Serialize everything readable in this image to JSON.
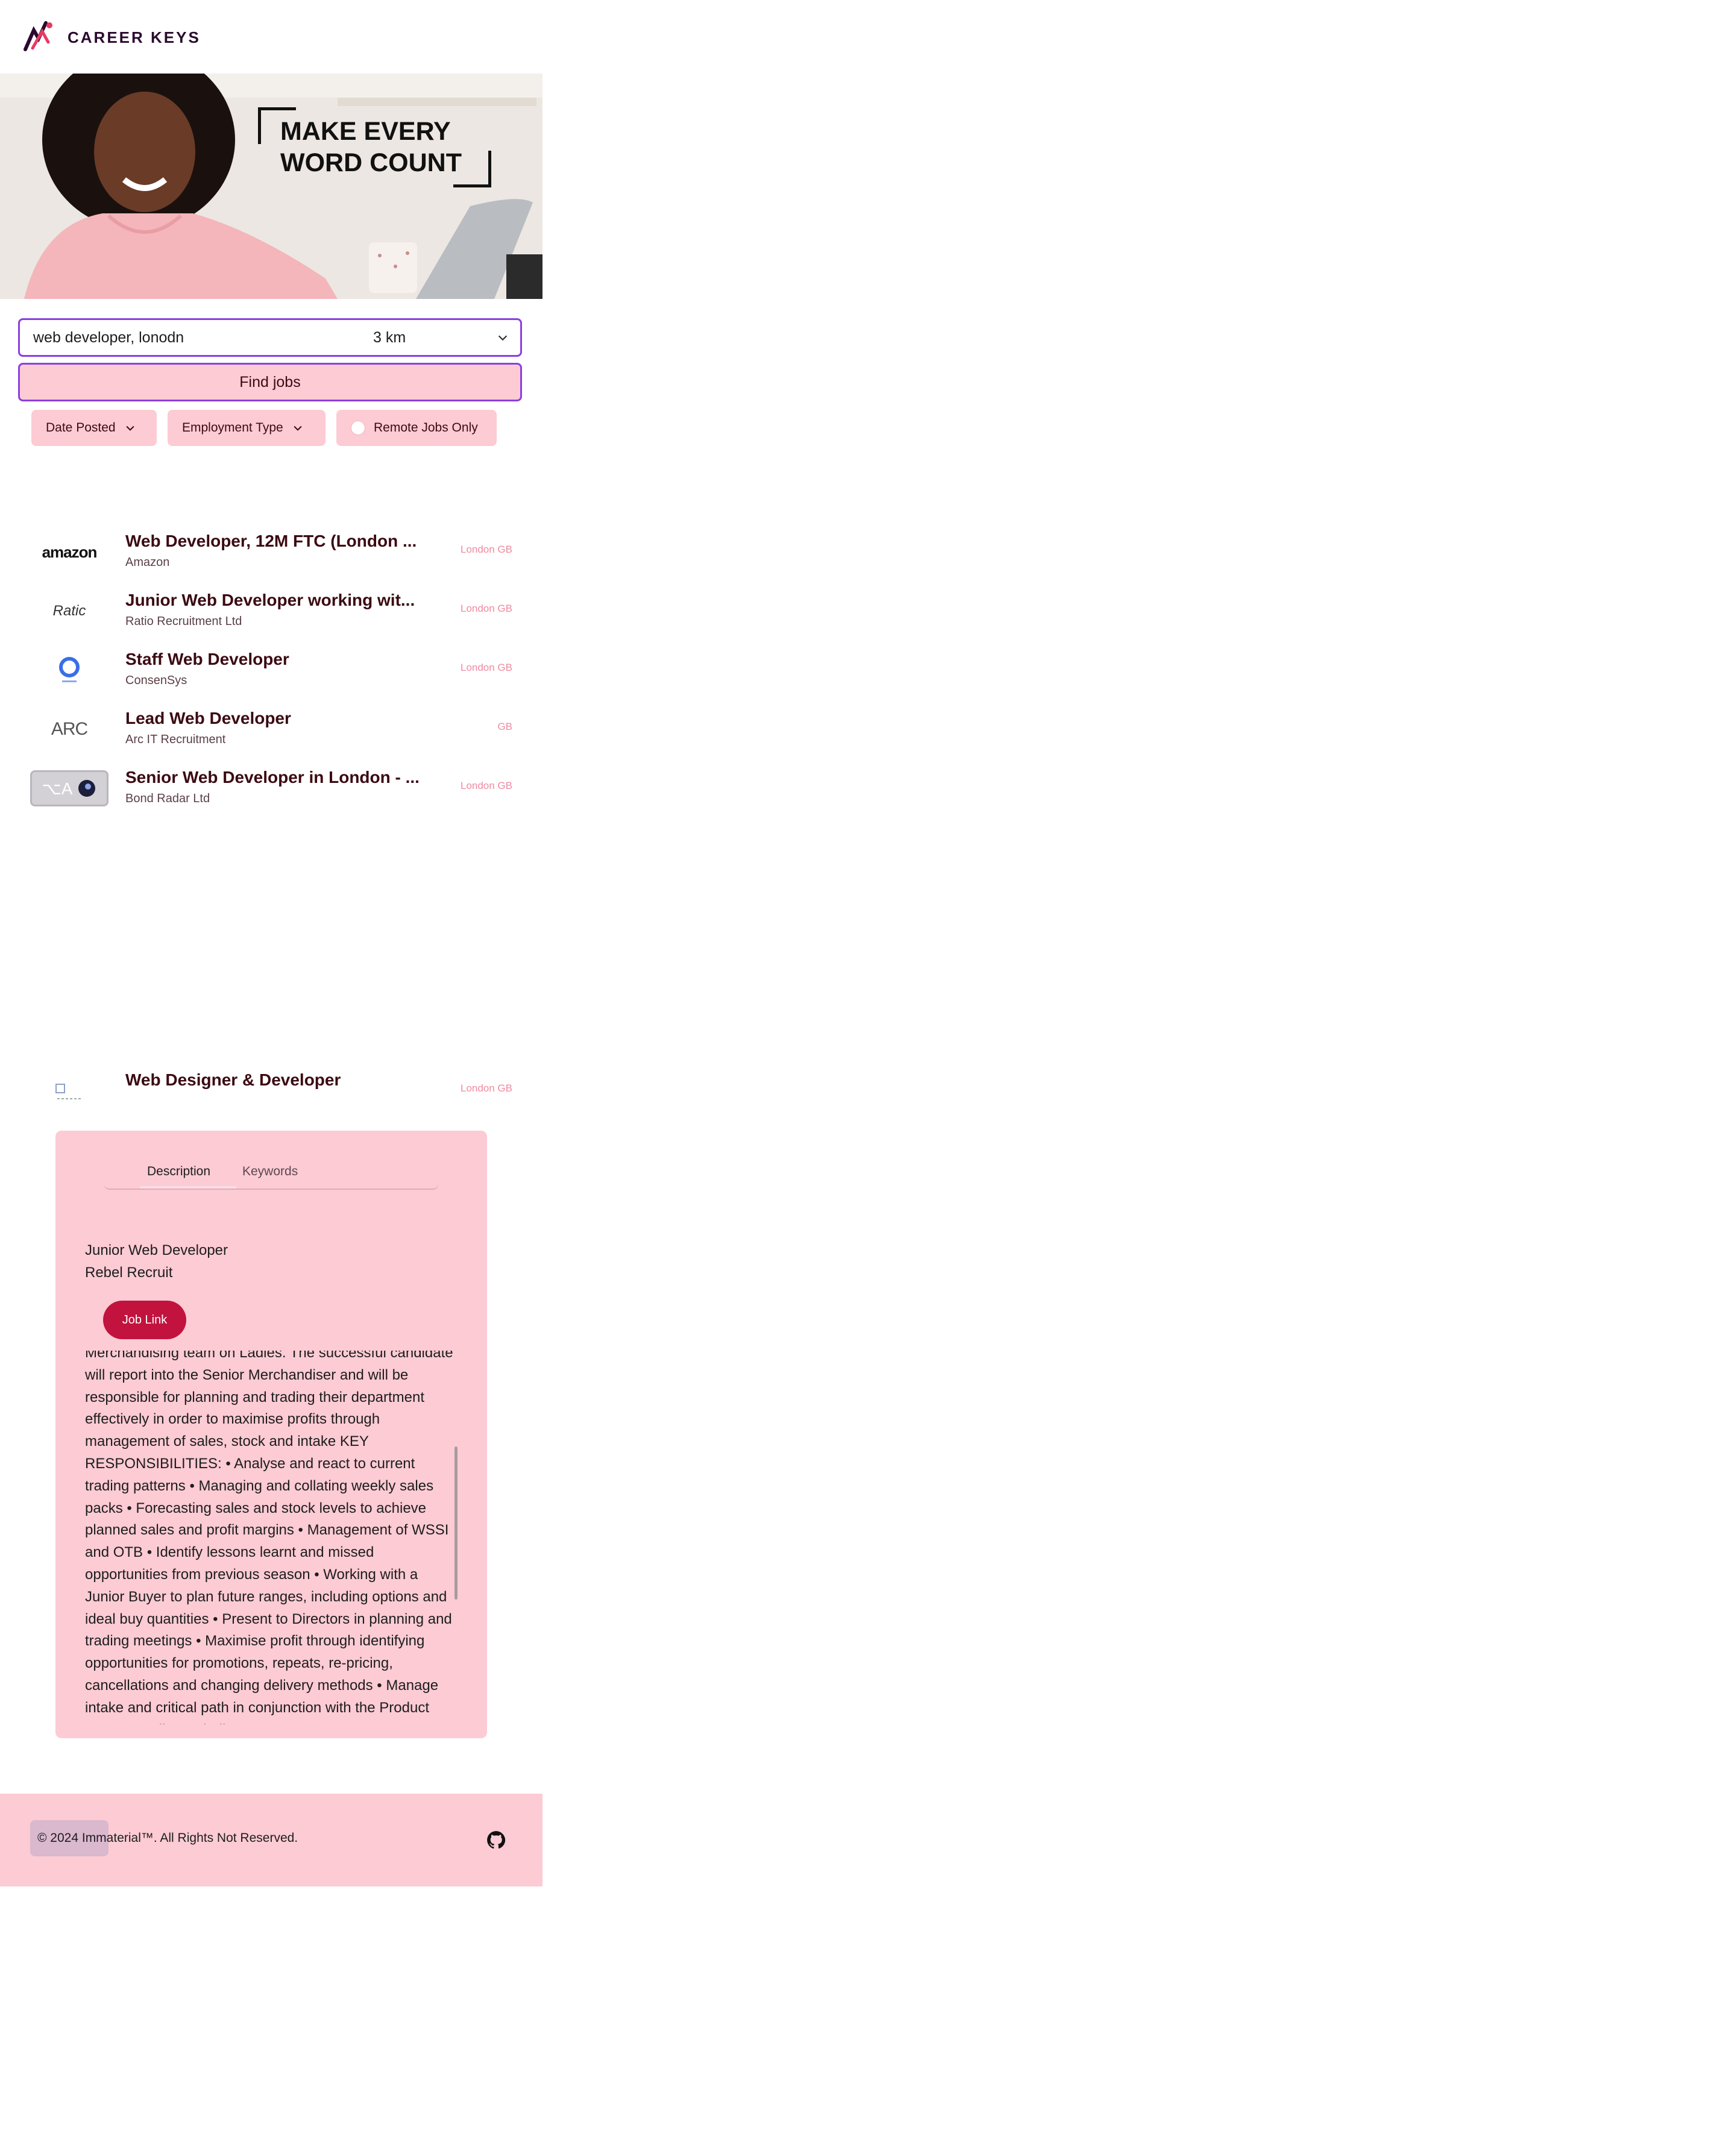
{
  "brand": {
    "name": "CAREER KEYS"
  },
  "hero": {
    "headline_line1": "MAKE EVERY",
    "headline_line2": "WORD COUNT"
  },
  "search": {
    "value": "web developer, lonodn",
    "radius": "3 km",
    "button_label": "Find jobs"
  },
  "filters": {
    "date_posted": "Date Posted",
    "employment_type": "Employment Type",
    "remote_only": "Remote Jobs Only"
  },
  "jobs": [
    {
      "title": "Web Developer, 12M FTC (London ...",
      "company": "Amazon",
      "location": "London GB",
      "logo_text": "amazon"
    },
    {
      "title": "Junior Web Developer working wit...",
      "company": "Ratio Recruitment Ltd",
      "location": "London GB",
      "logo_text": "Ratic"
    },
    {
      "title": "Staff Web Developer",
      "company": "ConsenSys",
      "location": "London GB",
      "logo_text": ""
    },
    {
      "title": "Lead Web Developer",
      "company": "Arc IT Recruitment",
      "location": "GB",
      "logo_text": "ARC"
    },
    {
      "title": "Senior Web Developer in London - ...",
      "company": "Bond Radar Ltd",
      "location": "London GB",
      "logo_text": "⌥A"
    },
    {
      "title": "Web Designer & Developer",
      "company": "",
      "location": "London GB",
      "logo_text": ""
    }
  ],
  "detail": {
    "tabs": {
      "description": "Description",
      "keywords": "Keywords"
    },
    "job_title": "Junior Web Developer",
    "company": "Rebel Recruit",
    "link_label": "Job Link",
    "description": "Merchandising team on Ladies. The successful candidate will report into the Senior Merchandiser and will be responsible for planning and trading their department effectively in order to maximise profits through management of sales, stock and intake KEY RESPONSIBILITIES: • Analyse and react to current trading patterns • Managing and collating weekly sales packs • Forecasting sales and stock levels to achieve planned sales and profit margins • Management of WSSI and OTB • Identify lessons learnt and missed opportunities from previous season • Working with a Junior Buyer to plan future ranges, including options and ideal buy quantities • Present to Directors in planning and trading meetings • Maximise profit through identifying opportunities for promotions, repeats, re-pricing, cancellations and changing delivery methods • Manage intake and critical path in conjunction with the Product team, Supplier and Allocators"
  },
  "footer": {
    "copyright": "© 2024 Immaterial™. All Rights Not Reserved."
  },
  "colors": {
    "accent_pink": "#fccbd4",
    "accent_purple": "#8b3fe0",
    "link_red": "#c2123e",
    "text_maroon": "#3b0a12",
    "location_pink": "#f08aa0"
  },
  "icons": [
    "logo-mark-icon",
    "chevron-down-icon",
    "github-icon"
  ]
}
